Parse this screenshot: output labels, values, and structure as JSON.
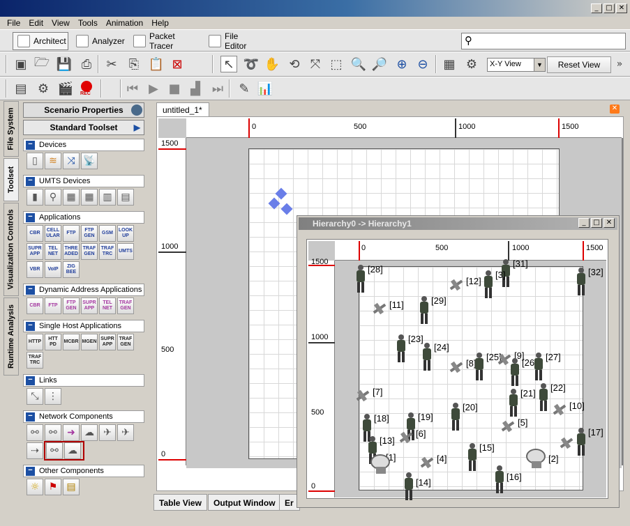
{
  "menu": {
    "items": [
      "File",
      "Edit",
      "View",
      "Tools",
      "Animation",
      "Help"
    ]
  },
  "apptabs": {
    "architect": "Architect",
    "analyzer": "Analyzer",
    "packet_tracer": "Packet Tracer",
    "file_editor": "File Editor"
  },
  "toolbar": {
    "view_select": "X-Y View",
    "reset_view": "Reset View",
    "rec": "REC"
  },
  "vtabs": {
    "file_system": "File System",
    "toolset": "Toolset",
    "visualization": "Visualization Controls",
    "runtime": "Runtime Analysis"
  },
  "panel": {
    "scenario": "Scenario Properties",
    "standard": "Standard Toolset",
    "sections": {
      "devices": "Devices",
      "umts": "UMTS Devices",
      "applications": "Applications",
      "dynamic": "Dynamic Address Applications",
      "single": "Single Host Applications",
      "links": "Links",
      "network": "Network Components",
      "other": "Other Components"
    },
    "app_tools": [
      "CBR",
      "CELL\nULAR",
      "FTP",
      "FTP\nGEN",
      "GSM",
      "LOOK\nUP",
      "SUPR\nAPP",
      "TEL\nNET",
      "THRE\nADED",
      "TRAF\nGEN",
      "TRAF\nTRC",
      "UMTS",
      "VBR",
      "VoIP",
      "ZIG\nBEE"
    ],
    "dyn_tools": [
      "CBR",
      "FTP",
      "FTP\nGEN",
      "SUPR\nAPP",
      "TEL\nNET",
      "TRAF\nGEN"
    ],
    "single_tools": [
      "HTTP",
      "HTT\nPD",
      "MCBR",
      "MGEN",
      "SUPR\nAPP",
      "TRAF\nGEN",
      "TRAF\nTRC"
    ]
  },
  "doc": {
    "tab": "untitled_1*",
    "xticks": [
      "0",
      "500",
      "1000",
      "1500"
    ],
    "yticks": [
      "1500",
      "1000",
      "500",
      "0"
    ]
  },
  "bottomtabs": {
    "table": "Table View",
    "output": "Output Window",
    "err": "Er"
  },
  "sub": {
    "title": "Hierarchy0 -> Hierarchy1",
    "xticks": [
      "0",
      "500",
      "1000",
      "1500"
    ],
    "yticks": [
      "1500",
      "1000",
      "500",
      "0"
    ],
    "node_labels": {
      "n28": "[28]",
      "n31": "[31]",
      "n32": "[32]",
      "n12": "[12]",
      "n3": "[3]",
      "n11": "[11]",
      "n29": "[29]",
      "n23": "[23]",
      "n24": "[24]",
      "n8": "[8]",
      "n25": "[25]",
      "n9": "[9]",
      "n26": "[26]",
      "n27": "[27]",
      "n7": "[7]",
      "n21": "[21]",
      "n22": "[22]",
      "n10": "[10]",
      "n20": "[20]",
      "n5": "[5]",
      "n18": "[18]",
      "n19": "[19]",
      "n13": "[13]",
      "n6": "[6]",
      "n17": "[17]",
      "n1": "[1]",
      "n4": "[4]",
      "n15": "[15]",
      "n2": "[2]",
      "n16": "[16]",
      "n14": "[14]"
    }
  }
}
